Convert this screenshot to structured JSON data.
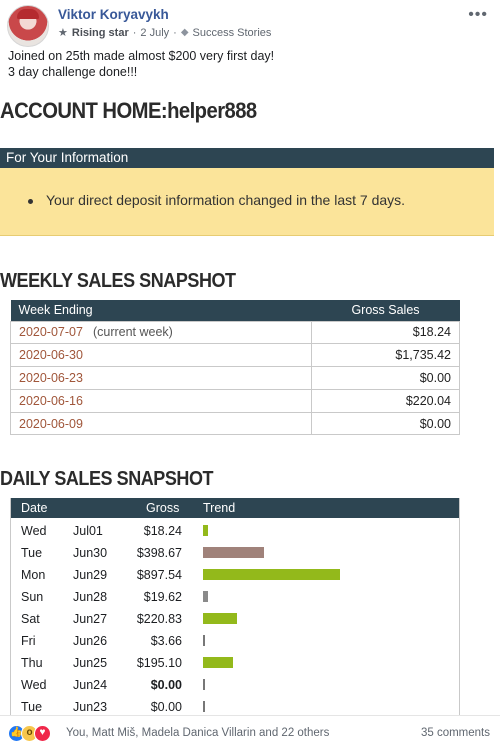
{
  "post": {
    "author": "Viktor Koryavykh",
    "badge": "Rising star",
    "date": "2 July",
    "separator": "·",
    "topic": "Success Stories",
    "text_line1": "Joined on 25th made almost $200 very first day!",
    "text_line2": "3 day challenge done!!!",
    "more_icon": "more-dots-icon"
  },
  "screenshot": {
    "account_title": "ACCOUNT HOME:helper888",
    "info": {
      "header": "For Your Information",
      "message": "Your direct deposit information changed in the last 7 days."
    },
    "weekly": {
      "title": "WEEKLY SALES SNAPSHOT",
      "col_week": "Week Ending",
      "col_gross": "Gross Sales",
      "rows": [
        {
          "week": "2020-07-07",
          "note": "(current week)",
          "gross": "$18.24"
        },
        {
          "week": "2020-06-30",
          "note": "",
          "gross": "$1,735.42"
        },
        {
          "week": "2020-06-23",
          "note": "",
          "gross": "$0.00"
        },
        {
          "week": "2020-06-16",
          "note": "",
          "gross": "$220.04"
        },
        {
          "week": "2020-06-09",
          "note": "",
          "gross": "$0.00"
        }
      ]
    },
    "daily": {
      "title": "DAILY SALES SNAPSHOT",
      "col_date": "Date",
      "col_gross": "Gross",
      "col_trend": "Trend",
      "rows": [
        {
          "dow": "Wed",
          "md": "Jul01",
          "gross": "$18.24",
          "value": 18.24,
          "color": "green",
          "bold": false
        },
        {
          "dow": "Tue",
          "md": "Jun30",
          "gross": "$398.67",
          "value": 398.67,
          "color": "brown",
          "bold": false
        },
        {
          "dow": "Mon",
          "md": "Jun29",
          "gross": "$897.54",
          "value": 897.54,
          "color": "green",
          "bold": false
        },
        {
          "dow": "Sun",
          "md": "Jun28",
          "gross": "$19.62",
          "value": 19.62,
          "color": "grey",
          "bold": false
        },
        {
          "dow": "Sat",
          "md": "Jun27",
          "gross": "$220.83",
          "value": 220.83,
          "color": "green",
          "bold": false
        },
        {
          "dow": "Fri",
          "md": "Jun26",
          "gross": "$3.66",
          "value": 3.66,
          "color": "line",
          "bold": false
        },
        {
          "dow": "Thu",
          "md": "Jun25",
          "gross": "$195.10",
          "value": 195.1,
          "color": "green",
          "bold": false
        },
        {
          "dow": "Wed",
          "md": "Jun24",
          "gross": "$0.00",
          "value": 0,
          "color": "line",
          "bold": true
        },
        {
          "dow": "Tue",
          "md": "Jun23",
          "gross": "$0.00",
          "value": 0,
          "color": "line",
          "bold": false
        }
      ]
    }
  },
  "footer": {
    "reactions": [
      "like-icon",
      "wow-icon",
      "love-icon"
    ],
    "reactors": "You, Matt Miš, Madela Danica Villarin and 22 others",
    "comments": "35 comments"
  },
  "colors": {
    "author_link": "#385898",
    "table_header": "#2d4552",
    "info_background": "#fbe49a",
    "week_link": "#a0563a",
    "trend_green": "#93b91b",
    "trend_brown": "#a0827a"
  }
}
